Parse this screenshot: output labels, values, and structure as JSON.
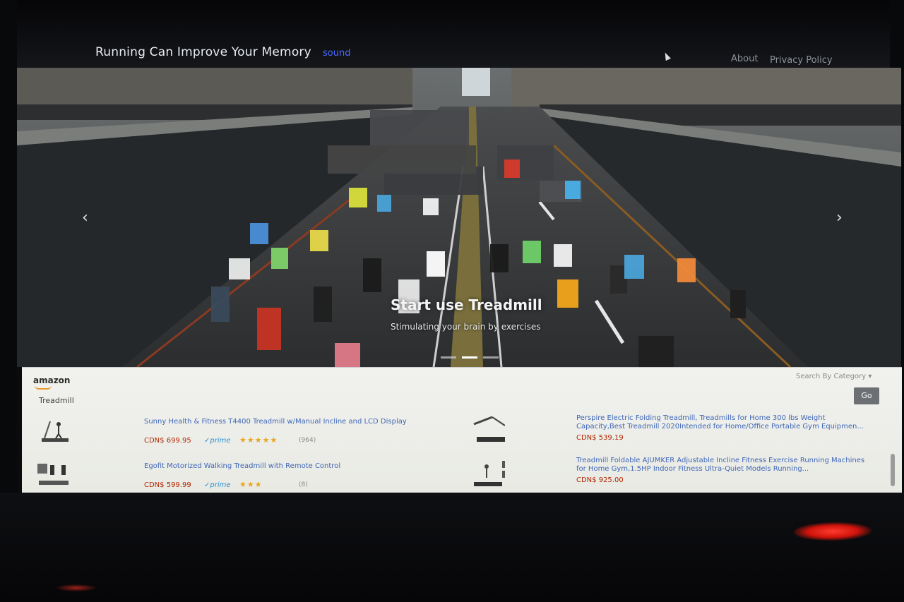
{
  "header": {
    "title": "Running Can Improve Your Memory",
    "sound_link": "sound",
    "nav": [
      "About",
      "Privacy Policy"
    ]
  },
  "hero": {
    "title": "Start use Treadmill",
    "subtitle": "Stimulating your brain by exercises",
    "prev_icon": "chevron-left-icon",
    "next_icon": "chevron-right-icon",
    "slides": 3,
    "active_slide": 1
  },
  "amazon_widget": {
    "logo": "amazon",
    "search_category": "Search By Category",
    "search_value": "Treadmill",
    "go_label": "Go",
    "products": [
      {
        "title": "Sunny Health & Fitness T4400 Treadmill w/Manual Incline and LCD Display",
        "price": "CDN$ 699.95",
        "prime": "prime",
        "stars": "★★★★★",
        "rating_count": "(964)"
      },
      {
        "title": "Egofit Motorized Walking Treadmill with Remote Control",
        "price": "CDN$ 599.99",
        "prime": "prime",
        "stars": "★★★",
        "rating_count": "(8)"
      },
      {
        "title": "Perspire Electric Folding Treadmill,  Treadmills for Home 300 lbs Weight Capacity,Best Treadmill 2020Intended for Home/Office Portable Gym Equipmen...",
        "price": "CDN$ 539.19"
      },
      {
        "title": "Treadmill Foldable AJUMKER Adjustable Incline Fitness Exercise Running Machines for Home Gym,1.5HP Indoor Fitness Ultra-Quiet Models Running...",
        "price": "CDN$ 925.00"
      }
    ]
  },
  "colors": {
    "link_blue": "#4a6cff",
    "price_red": "#b12704",
    "prime_blue": "#2f8fd1",
    "star_gold": "#e8a522"
  }
}
